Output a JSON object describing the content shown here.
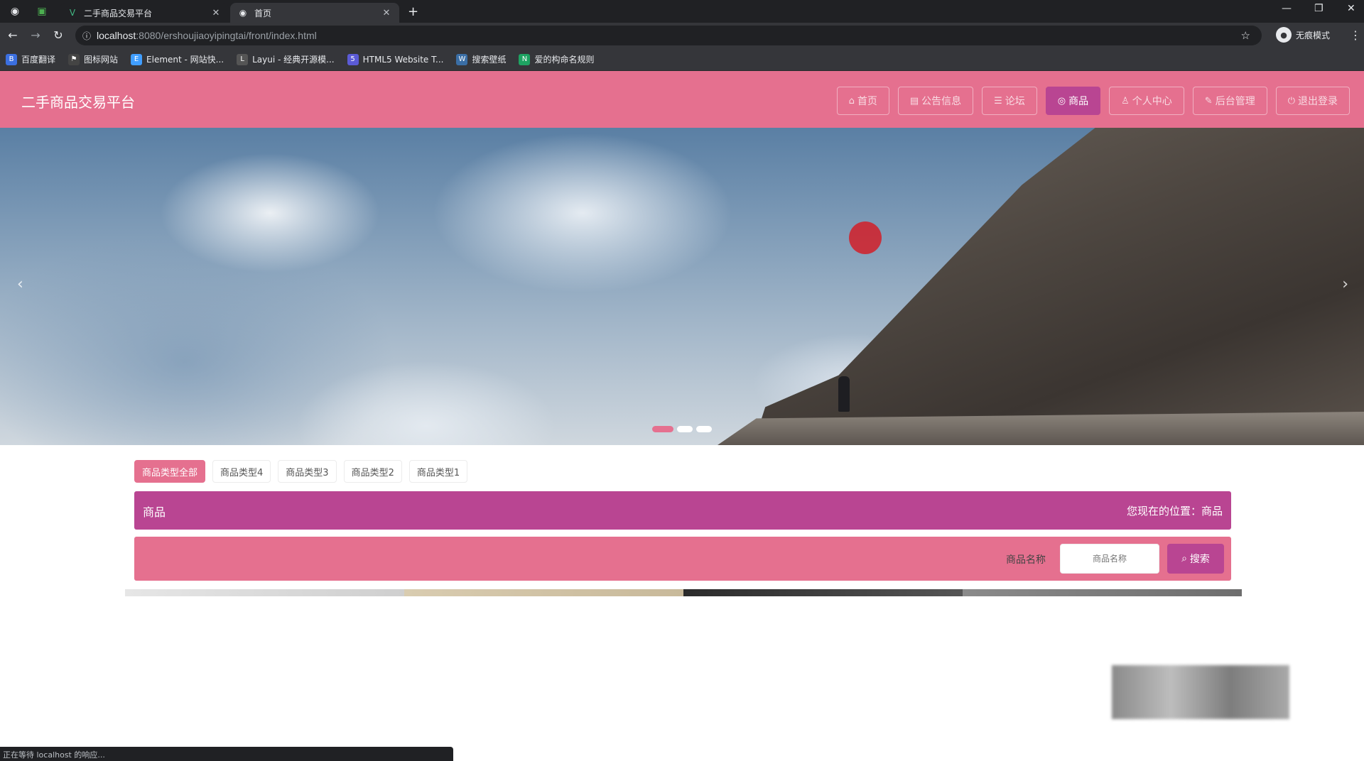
{
  "browser": {
    "tabs": [
      {
        "label": "二手商品交易平台",
        "favicon": "vue-logo-icon"
      },
      {
        "label": "首页",
        "favicon": "globe-icon"
      }
    ],
    "url_host": "localhost",
    "url_rest": ":8080/ershoujiaoyipingtai/front/index.html",
    "profile_label": "无痕模式",
    "bookmarks": [
      {
        "label": "百度翻译",
        "color": "#3b6fe0"
      },
      {
        "label": "图标网站",
        "color": "#444444"
      },
      {
        "label": "Element - 网站快...",
        "color": "#409eff"
      },
      {
        "label": "Layui - 经典开源模...",
        "color": "#555555"
      },
      {
        "label": "HTML5 Website T...",
        "color": "#5b5bd6"
      },
      {
        "label": "搜索壁纸",
        "color": "#3a6ea5"
      },
      {
        "label": "爱的构命名规则",
        "color": "#1ea362"
      }
    ],
    "status_text": "正在等待 localhost 的响应..."
  },
  "site": {
    "title": "二手商品交易平台",
    "nav": [
      {
        "label": "首页",
        "icon": "home-icon",
        "active": false
      },
      {
        "label": "公告信息",
        "icon": "notice-icon",
        "active": false
      },
      {
        "label": "论坛",
        "icon": "forum-icon",
        "active": false
      },
      {
        "label": "商品",
        "icon": "goods-icon",
        "active": true
      },
      {
        "label": "个人中心",
        "icon": "user-icon",
        "active": false
      },
      {
        "label": "后台管理",
        "icon": "admin-icon",
        "active": false
      },
      {
        "label": "退出登录",
        "icon": "logout-icon",
        "active": false
      }
    ]
  },
  "banner": {
    "dots_count": 3,
    "active_dot": 0
  },
  "categories": [
    {
      "label": "商品类型全部",
      "active": true
    },
    {
      "label": "商品类型4",
      "active": false
    },
    {
      "label": "商品类型3",
      "active": false
    },
    {
      "label": "商品类型2",
      "active": false
    },
    {
      "label": "商品类型1",
      "active": false
    }
  ],
  "breadcrumb": {
    "title": "商品",
    "location": "您现在的位置：商品"
  },
  "search": {
    "label": "商品名称",
    "placeholder": "商品名称",
    "button_label": "搜索"
  },
  "colors": {
    "primary": "#e5708f",
    "accent": "#b94592"
  }
}
